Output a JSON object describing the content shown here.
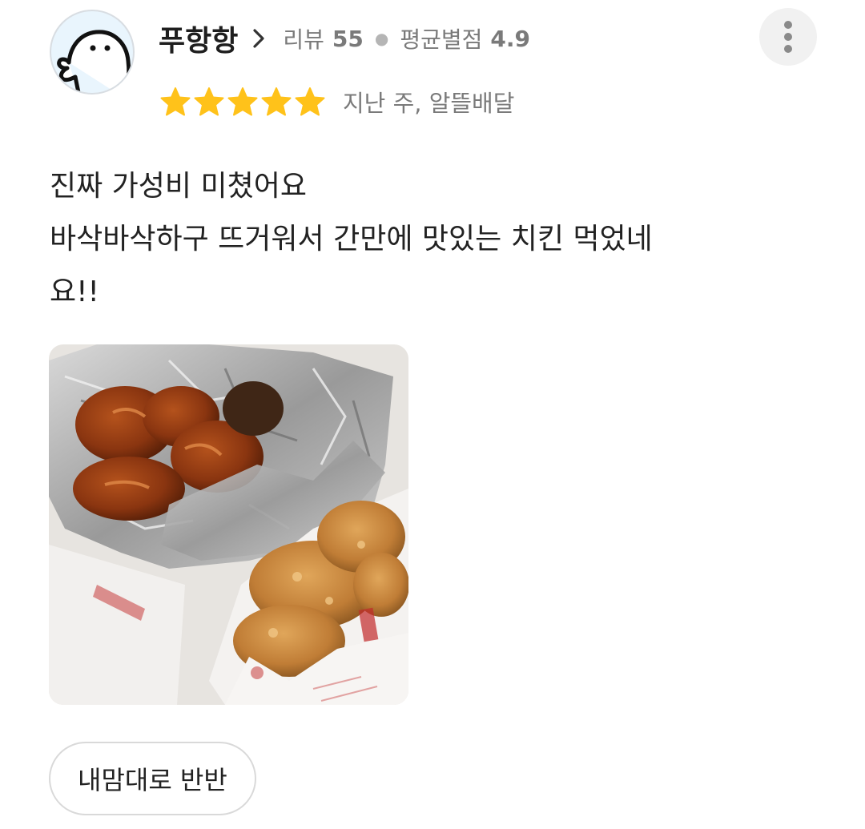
{
  "reviewer": {
    "nickname": "푸항항",
    "review_label": "리뷰",
    "review_count": "55",
    "avg_label": "평균별점",
    "avg_rating": "4.9"
  },
  "review": {
    "rating": 5,
    "max_rating": 5,
    "date": "지난 주, 알뜰배달",
    "text_lines": [
      "진짜 가성비 미쳤어요",
      "바삭바삭하구 뜨거워서 간만에 맛있는 치킨 먹었네",
      "요!!"
    ]
  },
  "menu_tag": "내맘대로 반반",
  "icons": {
    "avatar": "cartoon-face-avatar",
    "chevron": "chevron-right-icon",
    "more": "more-vertical-icon",
    "star": "star-icon"
  },
  "colors": {
    "star": "#ffc21a",
    "meta_text": "#7a7a7a",
    "avatar_bg": "#e9f5fd"
  }
}
